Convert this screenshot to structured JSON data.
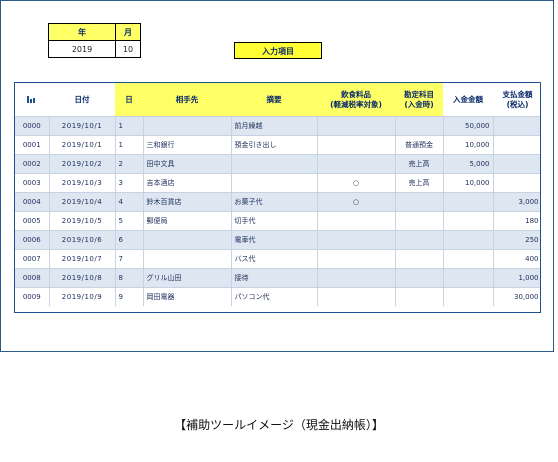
{
  "header": {
    "year_label": "年",
    "month_label": "月",
    "year_value": "2019",
    "month_value": "10",
    "input_button": "入力項目"
  },
  "table": {
    "columns": {
      "no_icon": "bar-chart-icon",
      "date": "日付",
      "day": "日",
      "partner": "相手先",
      "summary": "摘要",
      "food_line1": "飲食料品",
      "food_line2": "(軽減税率対象)",
      "account_line1": "勘定科目",
      "account_line2": "(入金時)",
      "deposit": "入金金額",
      "payment_line1": "支払金額",
      "payment_line2": "(税込)"
    },
    "rows": [
      {
        "no": "0000",
        "date": "2019/10/1",
        "day": "1",
        "partner": "",
        "summary": "前月繰越",
        "food": "",
        "account": "",
        "deposit": "50,000",
        "payment": ""
      },
      {
        "no": "0001",
        "date": "2019/10/1",
        "day": "1",
        "partner": "三和銀行",
        "summary": "預金引き出し",
        "food": "",
        "account": "普通預金",
        "deposit": "10,000",
        "payment": ""
      },
      {
        "no": "0002",
        "date": "2019/10/2",
        "day": "2",
        "partner": "田中文具",
        "summary": "",
        "food": "",
        "account": "売上高",
        "deposit": "5,000",
        "payment": ""
      },
      {
        "no": "0003",
        "date": "2019/10/3",
        "day": "3",
        "partner": "吉本酒店",
        "summary": "",
        "food": "○",
        "account": "売上高",
        "deposit": "10,000",
        "payment": ""
      },
      {
        "no": "0004",
        "date": "2019/10/4",
        "day": "4",
        "partner": "鈴木百貨店",
        "summary": "お菓子代",
        "food": "○",
        "account": "",
        "deposit": "",
        "payment": "3,000"
      },
      {
        "no": "0005",
        "date": "2019/10/5",
        "day": "5",
        "partner": "郵便局",
        "summary": "切手代",
        "food": "",
        "account": "",
        "deposit": "",
        "payment": "180"
      },
      {
        "no": "0006",
        "date": "2019/10/6",
        "day": "6",
        "partner": "",
        "summary": "電車代",
        "food": "",
        "account": "",
        "deposit": "",
        "payment": "250"
      },
      {
        "no": "0007",
        "date": "2019/10/7",
        "day": "7",
        "partner": "",
        "summary": "バス代",
        "food": "",
        "account": "",
        "deposit": "",
        "payment": "400"
      },
      {
        "no": "0008",
        "date": "2019/10/8",
        "day": "8",
        "partner": "グリル山田",
        "summary": "接待",
        "food": "",
        "account": "",
        "deposit": "",
        "payment": "1,000"
      },
      {
        "no": "0009",
        "date": "2019/10/9",
        "day": "9",
        "partner": "岡田電器",
        "summary": "パソコン代",
        "food": "",
        "account": "",
        "deposit": "",
        "payment": "30,000"
      }
    ]
  },
  "caption": "【補助ツールイメージ（現金出納帳）】",
  "colors": {
    "header_yellow": "#ffff66",
    "button_yellow": "#ffff33",
    "row_shade": "#dde6f1",
    "text_navy": "#0a2a6a",
    "frame_blue": "#2d5b8c"
  }
}
